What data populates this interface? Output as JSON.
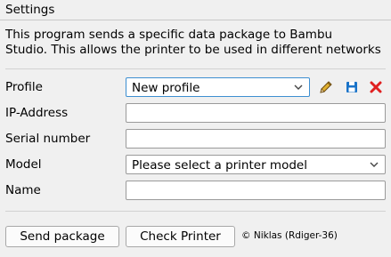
{
  "window": {
    "title": "Settings"
  },
  "description": {
    "line1": "This program sends a specific data package to Bambu",
    "line2": "Studio. This allows the printer to be used in different networks"
  },
  "form": {
    "profile": {
      "label": "Profile",
      "value": "New profile",
      "actions": {
        "edit_icon": "pencil-icon",
        "save_icon": "floppy-disk-icon",
        "delete_icon": "red-x-icon"
      }
    },
    "ip_address": {
      "label": "IP-Address",
      "value": ""
    },
    "serial_number": {
      "label": "Serial number",
      "value": ""
    },
    "model": {
      "label": "Model",
      "value": "Please select a printer model"
    },
    "name": {
      "label": "Name",
      "value": ""
    }
  },
  "footer": {
    "send_label": "Send package",
    "check_label": "Check Printer",
    "copyright": "© Niklas (Rdiger-36)"
  },
  "colors": {
    "background": "#f0f0f0",
    "focus_border": "#3d8fd1",
    "save_icon": "#1a73c8",
    "delete_icon": "#e02020",
    "edit_icon": "#d4a017"
  }
}
